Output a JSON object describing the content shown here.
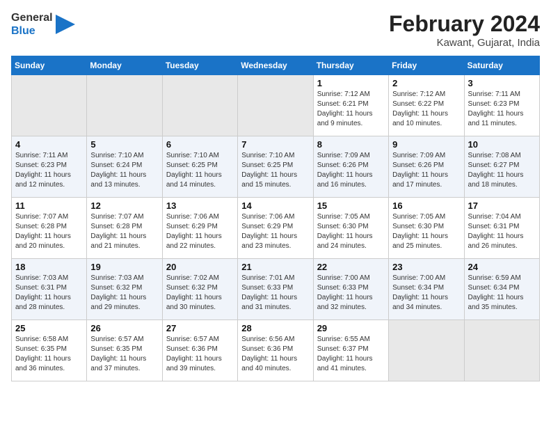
{
  "header": {
    "logo_line1": "General",
    "logo_line2": "Blue",
    "month_year": "February 2024",
    "location": "Kawant, Gujarat, India"
  },
  "weekdays": [
    "Sunday",
    "Monday",
    "Tuesday",
    "Wednesday",
    "Thursday",
    "Friday",
    "Saturday"
  ],
  "weeks": [
    [
      {
        "day": "",
        "info": ""
      },
      {
        "day": "",
        "info": ""
      },
      {
        "day": "",
        "info": ""
      },
      {
        "day": "",
        "info": ""
      },
      {
        "day": "1",
        "info": "Sunrise: 7:12 AM\nSunset: 6:21 PM\nDaylight: 11 hours\nand 9 minutes."
      },
      {
        "day": "2",
        "info": "Sunrise: 7:12 AM\nSunset: 6:22 PM\nDaylight: 11 hours\nand 10 minutes."
      },
      {
        "day": "3",
        "info": "Sunrise: 7:11 AM\nSunset: 6:23 PM\nDaylight: 11 hours\nand 11 minutes."
      }
    ],
    [
      {
        "day": "4",
        "info": "Sunrise: 7:11 AM\nSunset: 6:23 PM\nDaylight: 11 hours\nand 12 minutes."
      },
      {
        "day": "5",
        "info": "Sunrise: 7:10 AM\nSunset: 6:24 PM\nDaylight: 11 hours\nand 13 minutes."
      },
      {
        "day": "6",
        "info": "Sunrise: 7:10 AM\nSunset: 6:25 PM\nDaylight: 11 hours\nand 14 minutes."
      },
      {
        "day": "7",
        "info": "Sunrise: 7:10 AM\nSunset: 6:25 PM\nDaylight: 11 hours\nand 15 minutes."
      },
      {
        "day": "8",
        "info": "Sunrise: 7:09 AM\nSunset: 6:26 PM\nDaylight: 11 hours\nand 16 minutes."
      },
      {
        "day": "9",
        "info": "Sunrise: 7:09 AM\nSunset: 6:26 PM\nDaylight: 11 hours\nand 17 minutes."
      },
      {
        "day": "10",
        "info": "Sunrise: 7:08 AM\nSunset: 6:27 PM\nDaylight: 11 hours\nand 18 minutes."
      }
    ],
    [
      {
        "day": "11",
        "info": "Sunrise: 7:07 AM\nSunset: 6:28 PM\nDaylight: 11 hours\nand 20 minutes."
      },
      {
        "day": "12",
        "info": "Sunrise: 7:07 AM\nSunset: 6:28 PM\nDaylight: 11 hours\nand 21 minutes."
      },
      {
        "day": "13",
        "info": "Sunrise: 7:06 AM\nSunset: 6:29 PM\nDaylight: 11 hours\nand 22 minutes."
      },
      {
        "day": "14",
        "info": "Sunrise: 7:06 AM\nSunset: 6:29 PM\nDaylight: 11 hours\nand 23 minutes."
      },
      {
        "day": "15",
        "info": "Sunrise: 7:05 AM\nSunset: 6:30 PM\nDaylight: 11 hours\nand 24 minutes."
      },
      {
        "day": "16",
        "info": "Sunrise: 7:05 AM\nSunset: 6:30 PM\nDaylight: 11 hours\nand 25 minutes."
      },
      {
        "day": "17",
        "info": "Sunrise: 7:04 AM\nSunset: 6:31 PM\nDaylight: 11 hours\nand 26 minutes."
      }
    ],
    [
      {
        "day": "18",
        "info": "Sunrise: 7:03 AM\nSunset: 6:31 PM\nDaylight: 11 hours\nand 28 minutes."
      },
      {
        "day": "19",
        "info": "Sunrise: 7:03 AM\nSunset: 6:32 PM\nDaylight: 11 hours\nand 29 minutes."
      },
      {
        "day": "20",
        "info": "Sunrise: 7:02 AM\nSunset: 6:32 PM\nDaylight: 11 hours\nand 30 minutes."
      },
      {
        "day": "21",
        "info": "Sunrise: 7:01 AM\nSunset: 6:33 PM\nDaylight: 11 hours\nand 31 minutes."
      },
      {
        "day": "22",
        "info": "Sunrise: 7:00 AM\nSunset: 6:33 PM\nDaylight: 11 hours\nand 32 minutes."
      },
      {
        "day": "23",
        "info": "Sunrise: 7:00 AM\nSunset: 6:34 PM\nDaylight: 11 hours\nand 34 minutes."
      },
      {
        "day": "24",
        "info": "Sunrise: 6:59 AM\nSunset: 6:34 PM\nDaylight: 11 hours\nand 35 minutes."
      }
    ],
    [
      {
        "day": "25",
        "info": "Sunrise: 6:58 AM\nSunset: 6:35 PM\nDaylight: 11 hours\nand 36 minutes."
      },
      {
        "day": "26",
        "info": "Sunrise: 6:57 AM\nSunset: 6:35 PM\nDaylight: 11 hours\nand 37 minutes."
      },
      {
        "day": "27",
        "info": "Sunrise: 6:57 AM\nSunset: 6:36 PM\nDaylight: 11 hours\nand 39 minutes."
      },
      {
        "day": "28",
        "info": "Sunrise: 6:56 AM\nSunset: 6:36 PM\nDaylight: 11 hours\nand 40 minutes."
      },
      {
        "day": "29",
        "info": "Sunrise: 6:55 AM\nSunset: 6:37 PM\nDaylight: 11 hours\nand 41 minutes."
      },
      {
        "day": "",
        "info": ""
      },
      {
        "day": "",
        "info": ""
      }
    ]
  ]
}
